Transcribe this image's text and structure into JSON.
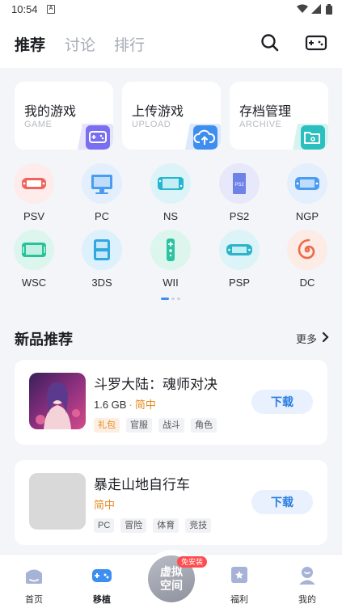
{
  "status_bar": {
    "time": "10:54",
    "notification_glyph": "A"
  },
  "header": {
    "tabs": [
      {
        "label": "推荐",
        "active": true
      },
      {
        "label": "讨论",
        "active": false
      },
      {
        "label": "排行",
        "active": false
      }
    ],
    "icons": [
      "search-icon",
      "gamepad-icon"
    ]
  },
  "shortcut_cards": [
    {
      "title": "我的游戏",
      "subtitle": "GAME",
      "icon": "gamepad-icon",
      "color": "#7a6ff0"
    },
    {
      "title": "上传游戏",
      "subtitle": "UPLOAD",
      "icon": "upload-cloud-icon",
      "color": "#3e8ef0"
    },
    {
      "title": "存档管理",
      "subtitle": "ARCHIVE",
      "icon": "folder-icon",
      "color": "#2bbfbf"
    }
  ],
  "platforms": [
    {
      "label": "PSV",
      "icon": "psv-icon"
    },
    {
      "label": "PC",
      "icon": "monitor-icon"
    },
    {
      "label": "NS",
      "icon": "switch-icon"
    },
    {
      "label": "PS2",
      "icon": "ps2-icon"
    },
    {
      "label": "NGP",
      "icon": "ngp-icon"
    },
    {
      "label": "WSC",
      "icon": "wsc-icon"
    },
    {
      "label": "3DS",
      "icon": "3ds-icon"
    },
    {
      "label": "WII",
      "icon": "wii-remote-icon"
    },
    {
      "label": "PSP",
      "icon": "psp-icon"
    },
    {
      "label": "DC",
      "icon": "dc-swirl-icon"
    }
  ],
  "new_games": {
    "title": "新品推荐",
    "more_label": "更多",
    "items": [
      {
        "name": "斗罗大陆：魂师对决",
        "size": "1.6 GB",
        "language": "简中",
        "tags": [
          "礼包",
          "官服",
          "战斗",
          "角色"
        ],
        "highlight_tag": "礼包",
        "download_label": "下载"
      },
      {
        "name": "暴走山地自行车",
        "size": "",
        "language": "简中",
        "tags": [
          "PC",
          "冒险",
          "体育",
          "竞技"
        ],
        "highlight_tag": "",
        "download_label": "下载"
      }
    ]
  },
  "bottom_nav": {
    "items": [
      {
        "label": "首页",
        "icon": "home-icon"
      },
      {
        "label": "移植",
        "icon": "gamepad-icon",
        "active": true
      },
      {
        "label": "福利",
        "icon": "gift-icon"
      },
      {
        "label": "我的",
        "icon": "profile-icon"
      }
    ],
    "center": {
      "label": "虚拟空间",
      "label_line1": "虚拟",
      "label_line2": "空间",
      "badge": "免安装"
    }
  },
  "colors": {
    "accent": "#2a7de1",
    "language": "#e58a1f",
    "badge": "#ff4d4f"
  }
}
